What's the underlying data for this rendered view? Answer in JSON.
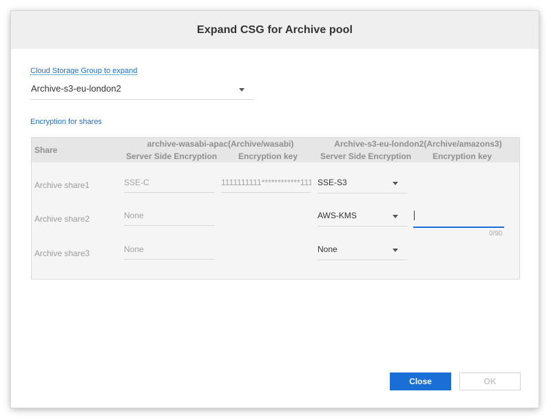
{
  "dialog": {
    "title": "Expand CSG for Archive pool"
  },
  "csg": {
    "label": "Cloud Storage Group to expand",
    "selected": "Archive-s3-eu-london2"
  },
  "encryption": {
    "label": "Encryption for shares",
    "share_header": "Share",
    "groups": [
      {
        "name": "archive-wasabi-apac(Archive/wasabi)",
        "col1": "Server Side Encryption",
        "col2": "Encryption key"
      },
      {
        "name": "Archive-s3-eu-london2(Archive/amazons3)",
        "col1": "Server Side Encryption",
        "col2": "Encryption key"
      }
    ],
    "rows": [
      {
        "share": "Archive share1",
        "wasabi_sse": "SSE-C",
        "wasabi_key": "1111111111************111",
        "s3_sse": "SSE-S3"
      },
      {
        "share": "Archive share2",
        "wasabi_sse": "None",
        "wasabi_key": "",
        "s3_sse": "AWS-KMS",
        "s3_key_value": "",
        "s3_key_counter": "0/90"
      },
      {
        "share": "Archive share3",
        "wasabi_sse": "None",
        "wasabi_key": "",
        "s3_sse": "None"
      }
    ]
  },
  "buttons": {
    "close": "Close",
    "ok": "OK"
  },
  "colors": {
    "accent": "#1a6fd6",
    "header_bg": "#efefef",
    "table_bg": "#f5f5f5",
    "table_head_bg": "#e6e6e6"
  }
}
